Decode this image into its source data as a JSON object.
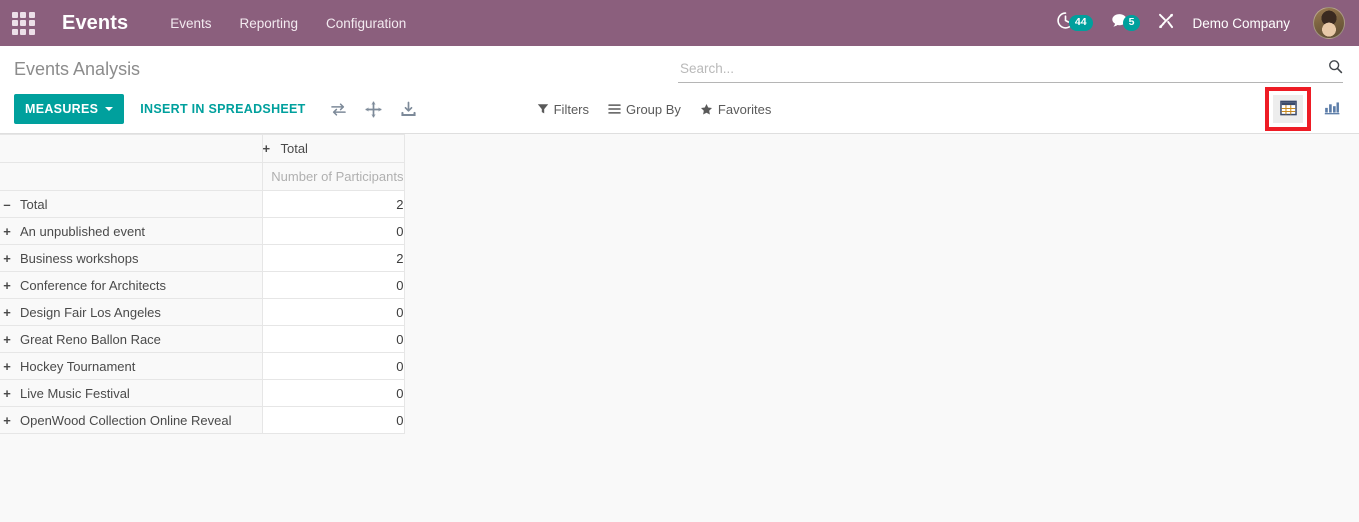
{
  "navbar": {
    "apps_icon": "apps-grid-icon",
    "brand": "Events",
    "menu": [
      {
        "label": "Events"
      },
      {
        "label": "Reporting"
      },
      {
        "label": "Configuration"
      }
    ],
    "tray": {
      "activities_icon": "clock-icon",
      "activities_count": "44",
      "messages_icon": "chat-bubble-icon",
      "messages_count": "5",
      "tools_icon": "tools-icon",
      "company": "Demo Company",
      "avatar_icon": "user-avatar"
    },
    "colors": {
      "background": "#8b5f7d",
      "badge": "#00a09d"
    }
  },
  "control_panel": {
    "breadcrumb": "Events Analysis",
    "measures_label": "MEASURES",
    "insert_spreadsheet_label": "INSERT IN SPREADSHEET",
    "tool_icons": [
      {
        "name": "flip-axis-icon"
      },
      {
        "name": "expand-all-icon"
      },
      {
        "name": "download-xlsx-icon"
      }
    ],
    "search": {
      "placeholder": "Search...",
      "value": "",
      "icon": "search-icon"
    },
    "filter_buttons": [
      {
        "label": "Filters",
        "icon": "filter-funnel-icon"
      },
      {
        "label": "Group By",
        "icon": "group-by-lines-icon"
      },
      {
        "label": "Favorites",
        "icon": "star-icon"
      }
    ],
    "view_switcher": [
      {
        "name": "pivot-view-button",
        "icon": "pivot-table-icon",
        "active": true,
        "highlighted": true
      },
      {
        "name": "graph-view-button",
        "icon": "bar-chart-icon",
        "active": false,
        "highlighted": false
      }
    ],
    "colors": {
      "accent": "#00a09d",
      "annotation": "#ee1c25"
    }
  },
  "pivot": {
    "column_header": {
      "toggle": "+",
      "label": "Total"
    },
    "measure_header": "Number of Participants",
    "rows": [
      {
        "toggle": "–",
        "label": "Total",
        "value": "2",
        "indent": 0
      },
      {
        "toggle": "+",
        "label": "An unpublished event",
        "value": "0",
        "indent": 1
      },
      {
        "toggle": "+",
        "label": "Business workshops",
        "value": "2",
        "indent": 1
      },
      {
        "toggle": "+",
        "label": "Conference for Architects",
        "value": "0",
        "indent": 1
      },
      {
        "toggle": "+",
        "label": "Design Fair Los Angeles",
        "value": "0",
        "indent": 1
      },
      {
        "toggle": "+",
        "label": "Great Reno Ballon Race",
        "value": "0",
        "indent": 1
      },
      {
        "toggle": "+",
        "label": "Hockey Tournament",
        "value": "0",
        "indent": 1
      },
      {
        "toggle": "+",
        "label": "Live Music Festival",
        "value": "0",
        "indent": 1
      },
      {
        "toggle": "+",
        "label": "OpenWood Collection Online Reveal",
        "value": "0",
        "indent": 1
      }
    ]
  }
}
